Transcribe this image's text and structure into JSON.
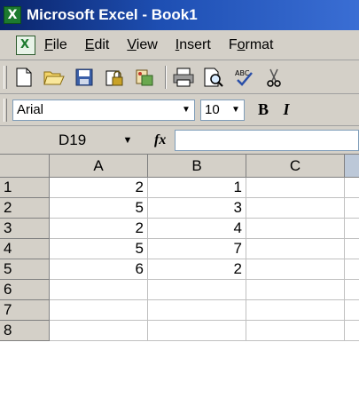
{
  "window": {
    "title": "Microsoft Excel - Book1"
  },
  "menu": {
    "items": [
      {
        "label": "File",
        "underline": "F"
      },
      {
        "label": "Edit",
        "underline": "E"
      },
      {
        "label": "View",
        "underline": "V"
      },
      {
        "label": "Insert",
        "underline": "I"
      },
      {
        "label": "Format",
        "underline": "o"
      }
    ]
  },
  "toolbar": {
    "buttons": [
      "new-icon",
      "open-icon",
      "save-icon",
      "permission-icon",
      "research-icon",
      "print-icon",
      "print-preview-icon",
      "spelling-icon",
      "cut-icon"
    ]
  },
  "formatting": {
    "font_name": "Arial",
    "font_size": "10",
    "bold_label": "B",
    "italic_label": "I"
  },
  "formula_bar": {
    "name_box": "D19",
    "fx_label": "fx",
    "formula": ""
  },
  "sheet": {
    "columns": [
      "A",
      "B",
      "C"
    ],
    "rows": [
      {
        "num": "1",
        "A": "2",
        "B": "1",
        "C": ""
      },
      {
        "num": "2",
        "A": "5",
        "B": "3",
        "C": ""
      },
      {
        "num": "3",
        "A": "2",
        "B": "4",
        "C": ""
      },
      {
        "num": "4",
        "A": "5",
        "B": "7",
        "C": ""
      },
      {
        "num": "5",
        "A": "6",
        "B": "2",
        "C": ""
      },
      {
        "num": "6",
        "A": "",
        "B": "",
        "C": ""
      },
      {
        "num": "7",
        "A": "",
        "B": "",
        "C": ""
      },
      {
        "num": "8",
        "A": "",
        "B": "",
        "C": ""
      }
    ]
  },
  "colors": {
    "title_bar": "#0a246a",
    "chrome": "#d4d0c8",
    "excel_green": "#1d7a2f"
  }
}
